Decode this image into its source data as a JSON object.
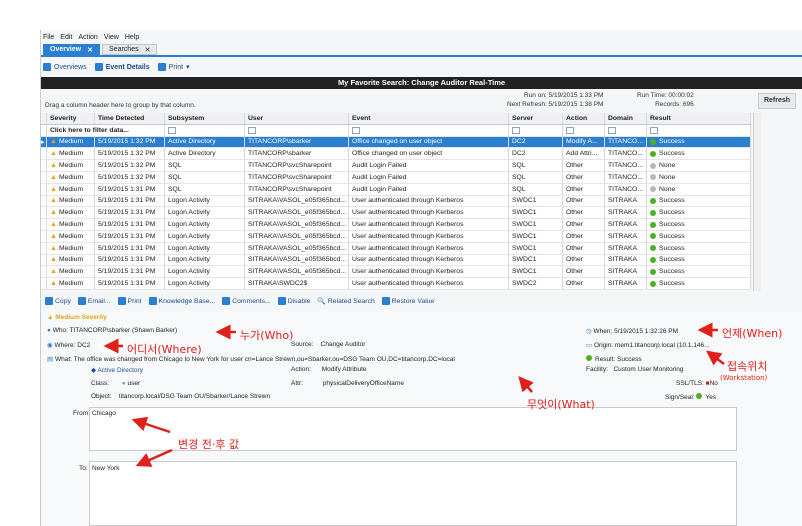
{
  "menu": [
    "File",
    "Edit",
    "Action",
    "View",
    "Help"
  ],
  "tabs": [
    {
      "label": "Overview",
      "close": "✕"
    },
    {
      "label": "Searches",
      "close": "✕"
    }
  ],
  "toolbar": {
    "overviews": "Overviews",
    "event_details": "Event Details",
    "print": "Print"
  },
  "search_title": "My Favorite Search: Change Auditor Real-Time",
  "info": {
    "drag_hint": "Drag a column header here to group by that column.",
    "run_on": "Run on: 5/19/2015 1:33 PM",
    "next_refresh": "Next Refresh: 5/19/2015 1:38 PM",
    "run_time": "Run Time: 00:00:02",
    "records": "Records: 696",
    "refresh": "Refresh"
  },
  "columns": [
    "Severity",
    "Time Detected",
    "Subsystem",
    "User",
    "Event",
    "Server",
    "Action",
    "Domain",
    "Result"
  ],
  "filter_label": "Click here to filter data...",
  "rows": [
    {
      "sev": "Medium",
      "time": "5/19/2015 1:32 PM",
      "sub": "Active Directory",
      "user": "TITANCORP\\sbarker",
      "event": "Office changed on user object",
      "server": "DC2",
      "action": "Modify A...",
      "domain": "TITANCO...",
      "result": "Success"
    },
    {
      "sev": "Medium",
      "time": "5/19/2015 1:32 PM",
      "sub": "Active Directory",
      "user": "TITANCORP\\sbarker",
      "event": "Office changed on user object",
      "server": "DC2",
      "action": "Add Attri...",
      "domain": "TITANCO...",
      "result": "Success"
    },
    {
      "sev": "Medium",
      "time": "5/19/2015 1:32 PM",
      "sub": "SQL",
      "user": "TITANCORP\\svcSharepoint",
      "event": "Audit Login Failed",
      "server": "SQL",
      "action": "Other",
      "domain": "TITANCO...",
      "result": "None"
    },
    {
      "sev": "Medium",
      "time": "5/19/2015 1:32 PM",
      "sub": "SQL",
      "user": "TITANCORP\\svcSharepoint",
      "event": "Audit Login Failed",
      "server": "SQL",
      "action": "Other",
      "domain": "TITANCO...",
      "result": "None"
    },
    {
      "sev": "Medium",
      "time": "5/19/2015 1:31 PM",
      "sub": "SQL",
      "user": "TITANCORP\\svcSharepoint",
      "event": "Audit Login Failed",
      "server": "SQL",
      "action": "Other",
      "domain": "TITANCO...",
      "result": "None"
    },
    {
      "sev": "Medium",
      "time": "5/19/2015 1:31 PM",
      "sub": "Logon Activity",
      "user": "SITRAKA\\VASOL_e05f365bcd...",
      "event": "User authenticated through Kerberos",
      "server": "SWDC1",
      "action": "Other",
      "domain": "SITRAKA",
      "result": "Success"
    },
    {
      "sev": "Medium",
      "time": "5/19/2015 1:31 PM",
      "sub": "Logon Activity",
      "user": "SITRAKA\\VASOL_e05f365bcd...",
      "event": "User authenticated through Kerberos",
      "server": "SWDC1",
      "action": "Other",
      "domain": "SITRAKA",
      "result": "Success"
    },
    {
      "sev": "Medium",
      "time": "5/19/2015 1:31 PM",
      "sub": "Logon Activity",
      "user": "SITRAKA\\VASOL_e05f365bcd...",
      "event": "User authenticated through Kerberos",
      "server": "SWDC1",
      "action": "Other",
      "domain": "SITRAKA",
      "result": "Success"
    },
    {
      "sev": "Medium",
      "time": "5/19/2015 1:31 PM",
      "sub": "Logon Activity",
      "user": "SITRAKA\\VASOL_e05f365bcd...",
      "event": "User authenticated through Kerberos",
      "server": "SWDC1",
      "action": "Other",
      "domain": "SITRAKA",
      "result": "Success"
    },
    {
      "sev": "Medium",
      "time": "5/19/2015 1:31 PM",
      "sub": "Logon Activity",
      "user": "SITRAKA\\VASOL_e05f365bcd...",
      "event": "User authenticated through Kerberos",
      "server": "SWDC1",
      "action": "Other",
      "domain": "SITRAKA",
      "result": "Success"
    },
    {
      "sev": "Medium",
      "time": "5/19/2015 1:31 PM",
      "sub": "Logon Activity",
      "user": "SITRAKA\\VASOL_e05f365bcd...",
      "event": "User authenticated through Kerberos",
      "server": "SWDC1",
      "action": "Other",
      "domain": "SITRAKA",
      "result": "Success"
    },
    {
      "sev": "Medium",
      "time": "5/19/2015 1:31 PM",
      "sub": "Logon Activity",
      "user": "SITRAKA\\VASOL_e05f365bcd...",
      "event": "User authenticated through Kerberos",
      "server": "SWDC1",
      "action": "Other",
      "domain": "SITRAKA",
      "result": "Success"
    },
    {
      "sev": "Medium",
      "time": "5/19/2015 1:31 PM",
      "sub": "Logon Activity",
      "user": "SITRAKA\\SWDC2$",
      "event": "User authenticated through Kerberos",
      "server": "SWDC2",
      "action": "Other",
      "domain": "SITRAKA",
      "result": "Success"
    }
  ],
  "actions": [
    "Copy",
    "Email...",
    "Print",
    "Knowledge Base...",
    "Comments...",
    "Disable",
    "Related Search",
    "Restore Value"
  ],
  "detail": {
    "severity": "Medium Severity",
    "who_label": "Who:",
    "who": "TITANCORP\\sbarker (Shawn Barker)",
    "where_label": "Where:",
    "where": "DC2",
    "source_label": "Source:",
    "source": "Change Auditor",
    "what_label": "What:",
    "what": "The office was changed from Chicago to New York for user cn=Lance Strewn,ou=Sbarker,ou=DSG Team OU,DC=titancorp,DC=local",
    "subsystem": "Active Directory",
    "action_label": "Action:",
    "action": "Modify Attribute",
    "class_label": "Class:",
    "class": "user",
    "attr_label": "Attr:",
    "attr": "physicalDeliveryOfficeName",
    "object_label": "Object:",
    "object": "titancorp.local/DSG Team OU/Sbarker/Lance Strewn",
    "when": "When: 5/19/2015 1:32:26 PM",
    "origin": "Origin: mem1.titancorp.local (10.1.146...",
    "result": "Result: Success",
    "facility_label": "Facility:",
    "facility": "Custom User Monitoring",
    "ssl_label": "SSL/TLS:",
    "ssl": "No",
    "sign_label": "Sign/Seal:",
    "sign": "Yes",
    "from_label": "From:",
    "from": "Chicago",
    "to_label": "To:",
    "to": "New York"
  },
  "annotations": {
    "who": "누가(Who)",
    "where": "어디서(Where)",
    "when": "언제(When)",
    "workstation": "접속위치",
    "workstation_sub": "(Workstation)",
    "what": "무엇이(What)",
    "change": "변경 전·후 값"
  },
  "colors": {
    "accent": "#2b7fd0",
    "success": "#4caf24",
    "warning": "#e3a21a",
    "annotation": "#e0201a",
    "none": "#b8b8b8"
  }
}
